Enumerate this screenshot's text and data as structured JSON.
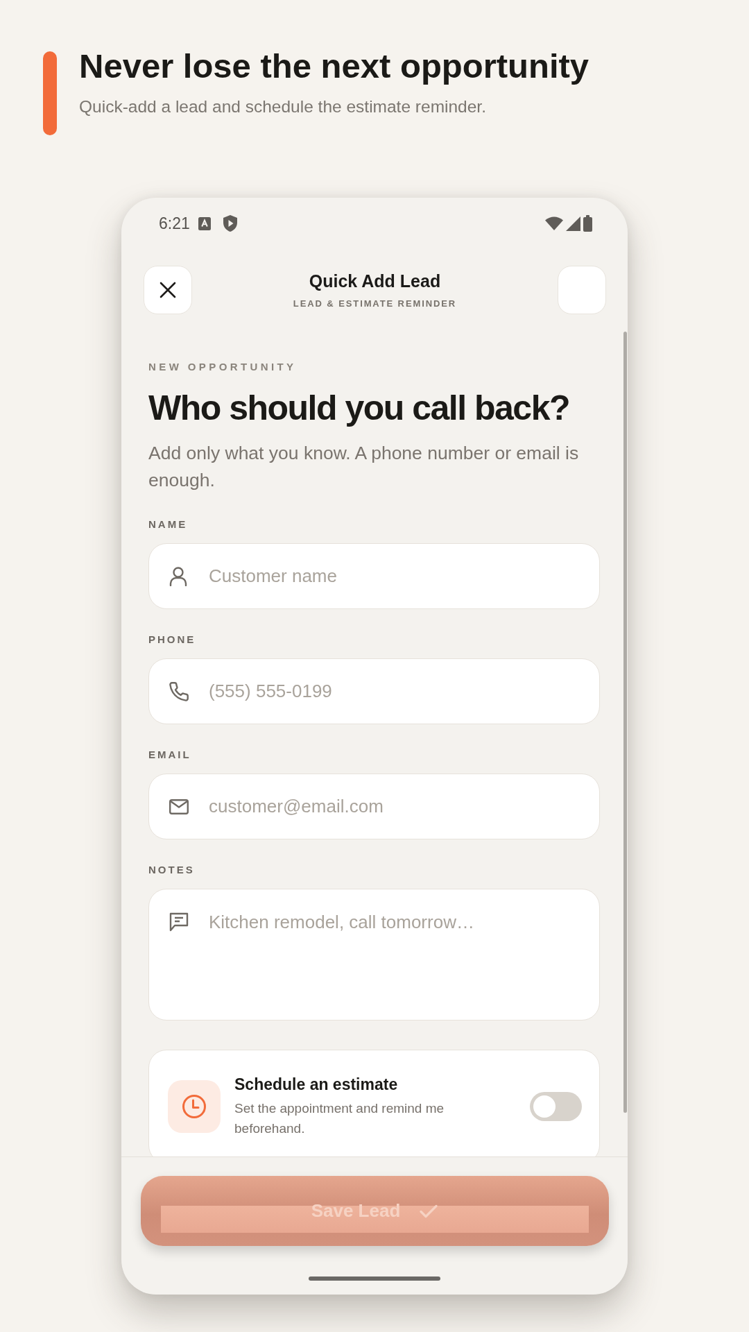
{
  "intro": {
    "title": "Never lose the next opportunity",
    "subtitle": "Quick-add a lead and schedule the estimate reminder."
  },
  "status_bar": {
    "time": "6:21"
  },
  "app_bar": {
    "title": "Quick Add Lead",
    "subtitle": "LEAD & ESTIMATE REMINDER"
  },
  "form": {
    "eyebrow": "NEW OPPORTUNITY",
    "heading": "Who should you call back?",
    "description": "Add only what you know. A phone number or email is enough.",
    "fields": [
      {
        "kind": "name",
        "label": "NAME",
        "placeholder": "Customer name"
      },
      {
        "kind": "phone",
        "label": "PHONE",
        "placeholder": "(555) 555-0199"
      },
      {
        "kind": "email",
        "label": "EMAIL",
        "placeholder": "customer@email.com"
      },
      {
        "kind": "notes",
        "label": "NOTES",
        "placeholder": "Kitchen remodel, call tomorrow…"
      }
    ]
  },
  "schedule": {
    "title": "Schedule an estimate",
    "description": "Set the appointment and remind me beforehand.",
    "on": false
  },
  "save_button": {
    "label": "Save Lead",
    "disabled": true
  }
}
